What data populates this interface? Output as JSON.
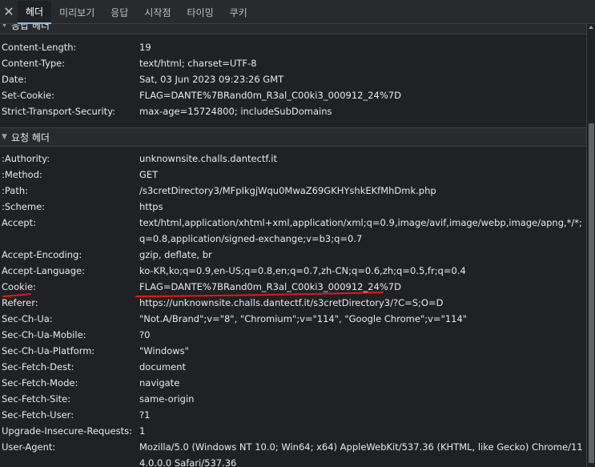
{
  "tabs": {
    "close_symbol": "✕",
    "items": [
      "헤더",
      "미리보기",
      "응답",
      "시작점",
      "타이밍",
      "쿠키"
    ]
  },
  "response_headers": {
    "title": "응답 헤더",
    "rows": [
      {
        "name": "Content-Length:",
        "value": "19"
      },
      {
        "name": "Content-Type:",
        "value": "text/html; charset=UTF-8"
      },
      {
        "name": "Date:",
        "value": "Sat, 03 Jun 2023 09:23:26 GMT"
      },
      {
        "name": "Set-Cookie:",
        "value": "FLAG=DANTE%7BRand0m_R3al_C00ki3_000912_24%7D"
      },
      {
        "name": "Strict-Transport-Security:",
        "value": "max-age=15724800; includeSubDomains"
      }
    ]
  },
  "request_headers": {
    "title": "요청 헤더",
    "rows": [
      {
        "name": ":Authority:",
        "value": "unknownsite.challs.dantectf.it"
      },
      {
        "name": ":Method:",
        "value": "GET"
      },
      {
        "name": ":Path:",
        "value": "/s3cretDirectory3/MFpIkgjWqu0MwaZ69GKHYshkEKfMhDmk.php"
      },
      {
        "name": ":Scheme:",
        "value": "https"
      },
      {
        "name": "Accept:",
        "value": "text/html,application/xhtml+xml,application/xml;q=0.9,image/avif,image/webp,image/apng,*/*;q=0.8,application/signed-exchange;v=b3;q=0.7"
      },
      {
        "name": "Accept-Encoding:",
        "value": "gzip, deflate, br"
      },
      {
        "name": "Accept-Language:",
        "value": "ko-KR,ko;q=0.9,en-US;q=0.8,en;q=0.7,zh-CN;q=0.6,zh;q=0.5,fr;q=0.4"
      },
      {
        "name": "Cookie:",
        "value": "FLAG=DANTE%7BRand0m_R3al_C00ki3_000912_24%7D"
      },
      {
        "name": "Referer:",
        "value": "https://unknownsite.challs.dantectf.it/s3cretDirectory3/?C=S;O=D"
      },
      {
        "name": "Sec-Ch-Ua:",
        "value": "\"Not.A/Brand\";v=\"8\", \"Chromium\";v=\"114\", \"Google Chrome\";v=\"114\""
      },
      {
        "name": "Sec-Ch-Ua-Mobile:",
        "value": "?0"
      },
      {
        "name": "Sec-Ch-Ua-Platform:",
        "value": "\"Windows\""
      },
      {
        "name": "Sec-Fetch-Dest:",
        "value": "document"
      },
      {
        "name": "Sec-Fetch-Mode:",
        "value": "navigate"
      },
      {
        "name": "Sec-Fetch-Site:",
        "value": "same-origin"
      },
      {
        "name": "Sec-Fetch-User:",
        "value": "?1"
      },
      {
        "name": "Upgrade-Insecure-Requests:",
        "value": "1"
      },
      {
        "name": "User-Agent:",
        "value": "Mozilla/5.0 (Windows NT 10.0; Win64; x64) AppleWebKit/537.36 (KHTML, like Gecko) Chrome/114.0.0.0 Safari/537.36"
      }
    ]
  },
  "colors": {
    "background": "#202124",
    "active_tab_underline": "#8ab4f8",
    "annotation_red": "#e0191b"
  }
}
